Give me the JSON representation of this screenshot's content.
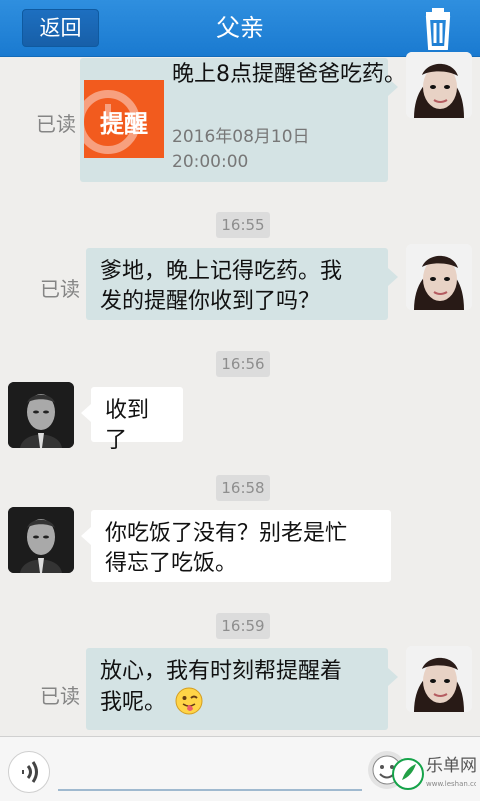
{
  "header": {
    "back_label": "返回",
    "title": "父亲",
    "trash_icon": "trash-icon"
  },
  "messages": [
    {
      "type": "reminder",
      "side": "right",
      "read": "已读",
      "icon_text": "提醒",
      "title": "晚上8点提醒爸爸吃药。",
      "date": "2016年08月10日",
      "clock": "20:00:00"
    },
    {
      "type": "time",
      "text": "16:55"
    },
    {
      "type": "text",
      "side": "right",
      "read": "已读",
      "lines": [
        "爹地，晚上记得吃药。我",
        "发的提醒你收到了吗？"
      ]
    },
    {
      "type": "time",
      "text": "16:56"
    },
    {
      "type": "text",
      "side": "left",
      "lines": [
        "收到了"
      ]
    },
    {
      "type": "time",
      "text": "16:58"
    },
    {
      "type": "text",
      "side": "left",
      "lines": [
        "你吃饭了没有？别老是忙",
        "得忘了吃饭。"
      ]
    },
    {
      "type": "time",
      "text": "16:59"
    },
    {
      "type": "text",
      "side": "right",
      "read": "已读",
      "lines": [
        "放心，我有时刻帮提醒着",
        "我呢。"
      ],
      "emoji": "tongue-out-emoji"
    }
  ],
  "input_bar": {
    "voice_icon": "voice-icon",
    "emoji_icon": "emoji-icon",
    "placeholder": ""
  },
  "watermark": {
    "text": "乐单网",
    "domain": "www.leshan.com"
  },
  "colors": {
    "header": "#1f82d7",
    "bubble_right": "#d4e3e4",
    "bubble_left": "#ffffff",
    "reminder_orange": "#f25b1e"
  }
}
